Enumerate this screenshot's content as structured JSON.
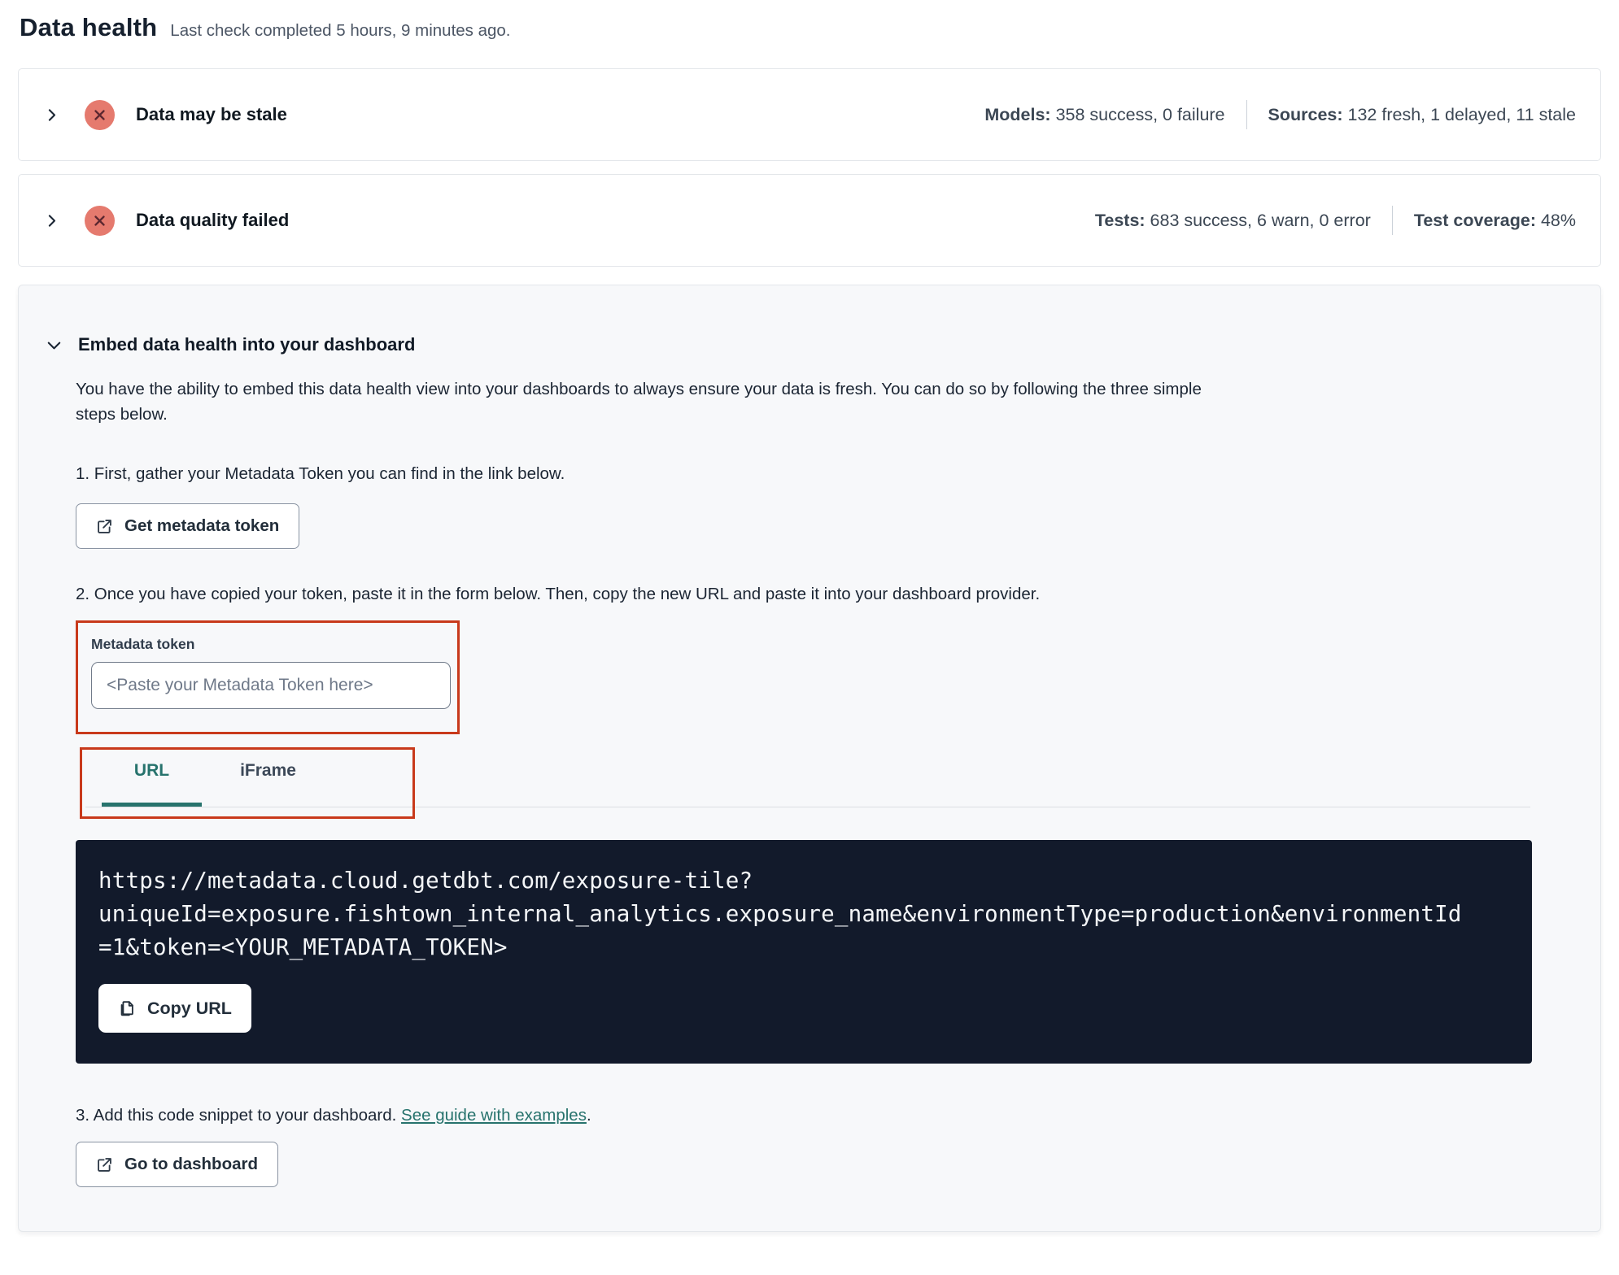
{
  "header": {
    "title": "Data health",
    "subtitle": "Last check completed 5 hours, 9 minutes ago."
  },
  "cards": {
    "stale": {
      "title": "Data may be stale",
      "stats": [
        {
          "label": "Models:",
          "value": " 358 success, 0 failure"
        },
        {
          "label": "Sources:",
          "value": " 132 fresh, 1 delayed, 11 stale"
        }
      ]
    },
    "quality": {
      "title": "Data quality failed",
      "stats": [
        {
          "label": "Tests:",
          "value": " 683 success, 6 warn, 0 error"
        },
        {
          "label": "Test coverage:",
          "value": " 48%"
        }
      ]
    }
  },
  "embed": {
    "title": "Embed data health into your dashboard",
    "description": "You have the ability to embed this data health view into your dashboards to always ensure your data is fresh. You can do so by following the three simple steps below.",
    "step1": {
      "text": "1. First, gather your Metadata Token you can find in the link below.",
      "button_label": "Get metadata token"
    },
    "step2": {
      "text": "2. Once you have copied your token, paste it in the form below. Then, copy the new URL and paste it into your dashboard provider.",
      "token_label": "Metadata token",
      "token_placeholder": "<Paste your Metadata Token here>",
      "tabs": [
        {
          "label": "URL"
        },
        {
          "label": "iFrame"
        }
      ],
      "code_lines": [
        "https://metadata.cloud.getdbt.com/exposure-tile?",
        "uniqueId=exposure.fishtown_internal_analytics.exposure_name&environmentType=production&environmentId",
        "=1&token=<YOUR_METADATA_TOKEN>"
      ],
      "copy_button_label": "Copy URL"
    },
    "step3": {
      "text": "3. Add this code snippet to your dashboard. ",
      "link_text": "See guide with examples",
      "text_after": ".",
      "button_label": "Go to dashboard"
    }
  },
  "icons": {
    "chevron_right": "chevron-right",
    "chevron_down": "chevron-down",
    "status_error": "x-circle",
    "external_link": "external-link",
    "copy": "copy"
  },
  "colors": {
    "accent_teal": "#27736d",
    "status_error_bg": "#e57a6e",
    "status_error_glyph": "#5c2730",
    "annotation_red": "#c8391b",
    "code_bg": "#121a2b"
  }
}
